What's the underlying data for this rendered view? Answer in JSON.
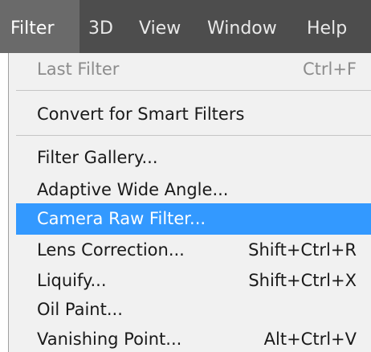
{
  "menubar": {
    "items": [
      {
        "label": "Filter"
      },
      {
        "label": "3D"
      },
      {
        "label": "View"
      },
      {
        "label": "Window"
      },
      {
        "label": "Help"
      }
    ]
  },
  "dropdown": {
    "items": [
      {
        "label": "Last Filter",
        "shortcut": "Ctrl+F"
      },
      {
        "label": "Convert for Smart Filters",
        "shortcut": ""
      },
      {
        "label": "Filter Gallery...",
        "shortcut": ""
      },
      {
        "label": "Adaptive Wide Angle...",
        "shortcut": ""
      },
      {
        "label": "Camera Raw Filter...",
        "shortcut": ""
      },
      {
        "label": "Lens Correction...",
        "shortcut": "Shift+Ctrl+R"
      },
      {
        "label": "Liquify...",
        "shortcut": "Shift+Ctrl+X"
      },
      {
        "label": "Oil Paint...",
        "shortcut": ""
      },
      {
        "label": "Vanishing Point...",
        "shortcut": "Alt+Ctrl+V"
      }
    ]
  },
  "colors": {
    "menubar_bg": "#4d4d4d",
    "menubar_active": "#6a6a6a",
    "dropdown_bg": "#f1f1f1",
    "highlight": "#3399ff",
    "disabled_text": "#8c8c8c"
  }
}
